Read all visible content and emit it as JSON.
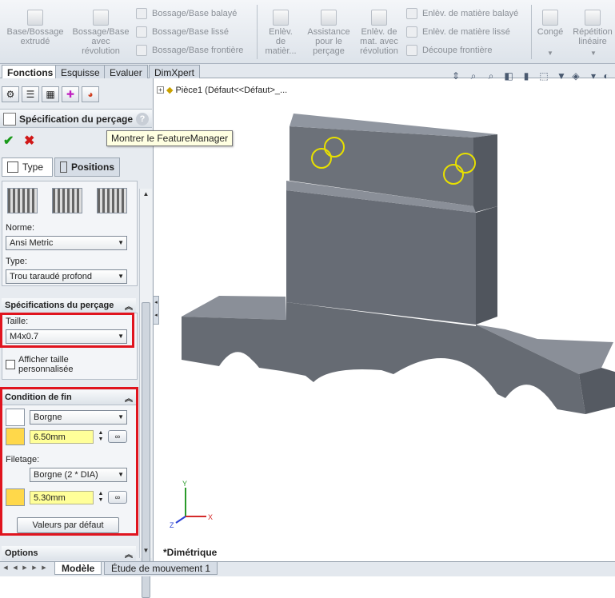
{
  "ribbon": {
    "buttons": [
      {
        "label1": "Base/Bossage",
        "label2": "extrudé"
      },
      {
        "label1": "Bossage/Base",
        "label2": "avec",
        "label3": "révolution"
      },
      {
        "label1": "Enlèv.",
        "label2": "de",
        "label3": "matièr..."
      },
      {
        "label1": "Assistance",
        "label2": "pour le",
        "label3": "perçage"
      },
      {
        "label1": "Enlèv. de",
        "label2": "mat. avec",
        "label3": "révolution"
      },
      {
        "label1": "Congé"
      },
      {
        "label1": "Répétition",
        "label2": "linéaire"
      }
    ],
    "small": [
      "Bossage/Base balayé",
      "Bossage/Base lissé",
      "Bossage/Base frontière",
      "Enlèv. de matière balayé",
      "Enlèv. de matière lissé",
      "Découpe frontière"
    ]
  },
  "tabs": [
    "Fonctions",
    "Esquisse",
    "Evaluer",
    "DimXpert"
  ],
  "panel": {
    "title": "Spécification du perçage",
    "help": "?",
    "ok": "✔",
    "cancel": "✖",
    "tooltip": "Montrer le FeatureManager",
    "subtabs": [
      "Type",
      "Positions"
    ],
    "norme_label": "Norme:",
    "norme_value": "Ansi Metric",
    "type_label": "Type:",
    "type_value": "Trou taraudé profond",
    "spec_title": "Spécifications du perçage",
    "taille_label": "Taille:",
    "taille_value": "M4x0.7",
    "custom_size_line1": "Afficher taille",
    "custom_size_line2": "personnalisée",
    "end_title": "Condition de fin",
    "end_value": "Borgne",
    "depth_value": "6.50mm",
    "filetage_label": "Filetage:",
    "filetage_value": "Borgne (2 * DIA)",
    "thread_depth_value": "5.30mm",
    "default_button": "Valeurs par défaut",
    "options_title": "Options"
  },
  "viewport": {
    "tree_label": "Pièce1  (Défaut<<Défaut>_...",
    "view_name": "*Dimétrique",
    "axis_x": "X",
    "axis_y": "Y",
    "axis_z": "Z"
  },
  "bottom_tabs": [
    "Modèle",
    "Étude de mouvement 1"
  ],
  "colors": {
    "highlight_red": "#e0141e",
    "hole_yellow": "#e8e000",
    "part_gray": "#6b7079",
    "input_yellow": "#ffff99"
  }
}
